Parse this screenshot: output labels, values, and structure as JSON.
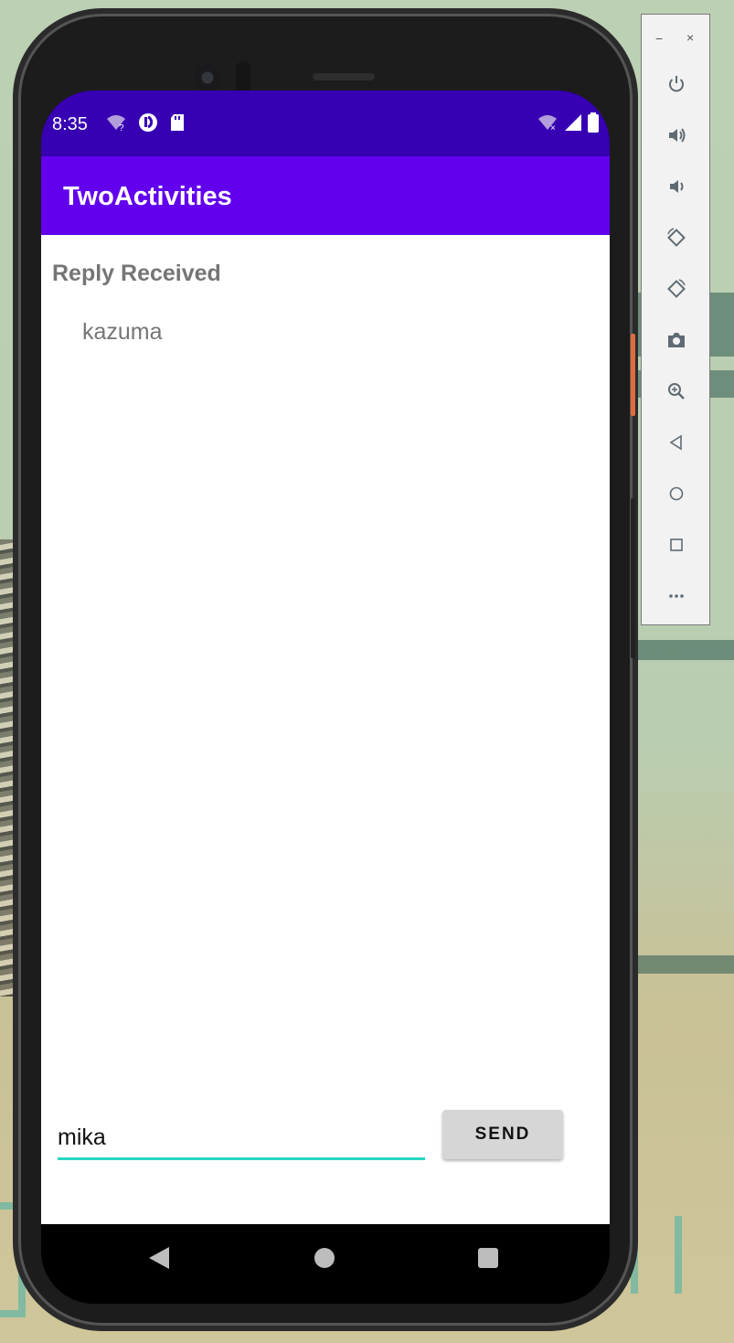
{
  "status_bar": {
    "time": "8:35",
    "left_icons": [
      "wifi-question-icon",
      "data-saver-icon",
      "sd-card-icon"
    ],
    "right_icons": [
      "wifi-off-icon",
      "signal-icon",
      "battery-icon"
    ]
  },
  "app_bar": {
    "title": "TwoActivities"
  },
  "main": {
    "reply_header": "Reply Received",
    "reply_text": "kazuma",
    "message_input": {
      "value": "mika",
      "placeholder": ""
    },
    "send_button_label": "SEND"
  },
  "nav_bar": {
    "items": [
      "back-icon",
      "home-icon",
      "recents-icon"
    ]
  },
  "emulator_toolbar": {
    "minimize_label": "−",
    "close_label": "×",
    "buttons": [
      "power-icon",
      "volume-up-icon",
      "volume-down-icon",
      "rotate-left-icon",
      "rotate-right-icon",
      "camera-icon",
      "zoom-icon",
      "back-icon",
      "home-icon",
      "overview-icon",
      "more-icon"
    ]
  },
  "colors": {
    "status_bar": "#3700b3",
    "app_bar": "#6200ee",
    "input_underline": "#26d7c3",
    "button_bg": "#d6d6d6"
  }
}
